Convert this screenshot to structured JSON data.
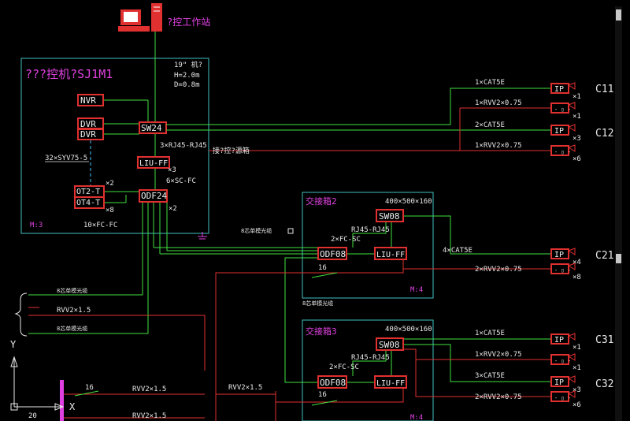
{
  "workstation": {
    "label": "?控工作站"
  },
  "cabinet": {
    "title": "???控机?SJ1M1",
    "spec": [
      "19\" 机?",
      "H=2.0m",
      "D=0.8m"
    ],
    "mark": "M:3",
    "devices": {
      "nvr": "NVR",
      "dvr1": "DVR",
      "dvr2": "DVR",
      "sw": "SW24",
      "liu": "LIU-FF",
      "ot1": "OT2-T",
      "ot2": "OT4-T",
      "odf": "ODF24"
    },
    "notes": {
      "rj45": "3×RJ45-RJ45",
      "x3": "×3",
      "sc": "6×SC-FC",
      "x2a": "×2",
      "x2b": "×2",
      "x8": "×8",
      "fc": "10×FC-FC",
      "coax": "32×SYV75-5"
    }
  },
  "box2": {
    "title": "交接箱2",
    "size": "400×500×160",
    "mark": "M:4",
    "devices": {
      "sw": "SW08",
      "odf": "ODF08",
      "liu": "LIU-FF"
    },
    "notes": {
      "rj45": "RJ45-RJ45",
      "sc": "2×FC-SC",
      "n16": "16"
    }
  },
  "box3": {
    "title": "交接箱3",
    "size": "400×500×160",
    "mark": "M:4",
    "devices": {
      "sw": "SW08",
      "odf": "ODF08",
      "liu": "LIU-FF"
    },
    "notes": {
      "rj45": "RJ45-RJ45",
      "sc": "2×FC-SC",
      "n16": "16"
    }
  },
  "right_cables": {
    "c1": "1×CAT5E",
    "c2": "1×RVV2×0.75",
    "c3": "2×CAT5E",
    "c4": "1×RVV2×0.75",
    "c5": "4×CAT5E",
    "c6": "2×RVV2×0.75",
    "c7": "1×CAT5E",
    "c8": "1×RVV2×0.75",
    "c9": "3×CAT5E",
    "c10": "2×RVV2×0.75",
    "door": "接?控?源箱"
  },
  "terminals": {
    "ip": "IP",
    "mult": {
      "m1": "×1",
      "m2": "×1",
      "m3": "×3",
      "m4": "×6",
      "m5": "×4",
      "m6": "×8",
      "m7": "×1",
      "m8": "×1",
      "m9": "×3",
      "m10": "×6"
    }
  },
  "zones": {
    "c11": "C11",
    "c12": "C12",
    "c21": "C21",
    "c31": "C31",
    "c32": "C32"
  },
  "left_feeds": {
    "fiber1": "8芯单模光缆",
    "fiber2": "8芯单模光缆",
    "fiber3": "8芯单模光缆",
    "fiber4": "8芯单模光缆",
    "rvv1": "RVV2×1.5",
    "rvv2": "RVV2×1.5",
    "rvv3": "RVV2×1.5",
    "rvv4": "RVV2×1.5",
    "n16": "16"
  },
  "ucs": {
    "y": "Y",
    "x": "X",
    "n": "20"
  },
  "colors": {
    "green": "#40e040",
    "red": "#e03030",
    "cyan": "#40c0c0",
    "magenta": "#e040e0",
    "dashed": "#40c0ff"
  }
}
